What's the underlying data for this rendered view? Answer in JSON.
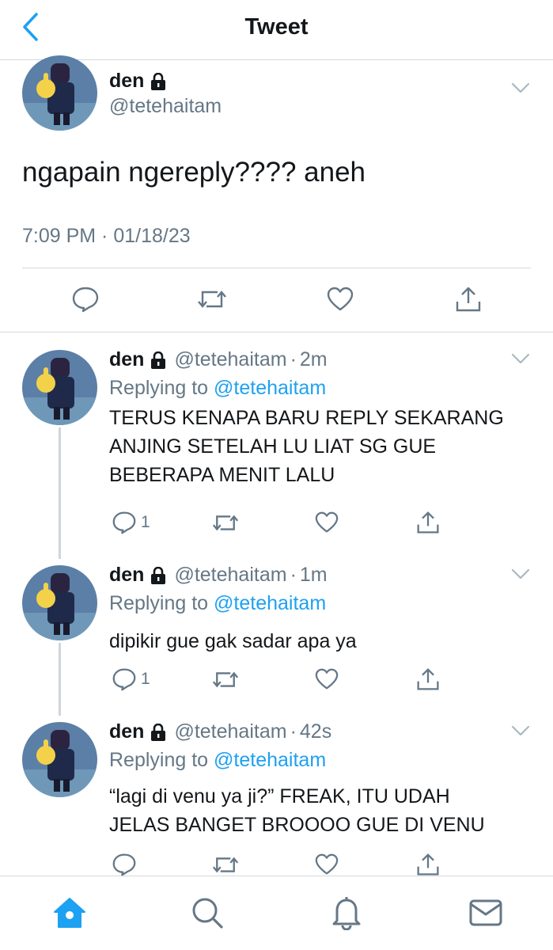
{
  "nav": {
    "title": "Tweet"
  },
  "main_tweet": {
    "display_name": "den",
    "handle": "@tetehaitam",
    "text": "ngapain ngereply???? aneh",
    "timestamp": "7:09 PM · 01/18/23"
  },
  "replies": [
    {
      "display_name": "den",
      "handle": "@tetehaitam",
      "separator": "·",
      "time": "2m",
      "replying_prefix": "Replying to",
      "replying_to": "@tetehaitam",
      "text_lines": [
        "TERUS KENAPA BARU REPLY SEKARANG",
        "ANJING SETELAH LU LIAT SG GUE",
        "BEBERAPA MENIT LALU"
      ],
      "reply_count": "1"
    },
    {
      "display_name": "den",
      "handle": "@tetehaitam",
      "separator": "·",
      "time": "1m",
      "replying_prefix": "Replying to",
      "replying_to": "@tetehaitam",
      "text_lines": [
        "dipikir gue gak sadar apa ya"
      ],
      "reply_count": "1"
    },
    {
      "display_name": "den",
      "handle": "@tetehaitam",
      "separator": "·",
      "time": "42s",
      "replying_prefix": "Replying to",
      "replying_to": "@tetehaitam",
      "text_lines": [
        "“lagi di venu ya ji?” FREAK, ITU UDAH",
        "JELAS BANGET BROOOO GUE DI VENU"
      ],
      "reply_count": ""
    }
  ],
  "icons": {
    "back": "chevron-left-icon",
    "lock": "lock-icon",
    "caret": "chevron-down-icon",
    "reply": "speech-bubble-icon",
    "retweet": "retweet-icon",
    "like": "heart-icon",
    "share": "share-icon",
    "home": "home-icon",
    "search": "search-icon",
    "notifications": "bell-icon",
    "messages": "envelope-icon"
  },
  "colors": {
    "accent": "#1da1f2",
    "secondary_text": "#657786",
    "primary_text": "#14171a",
    "divider": "#d4d8dc"
  }
}
